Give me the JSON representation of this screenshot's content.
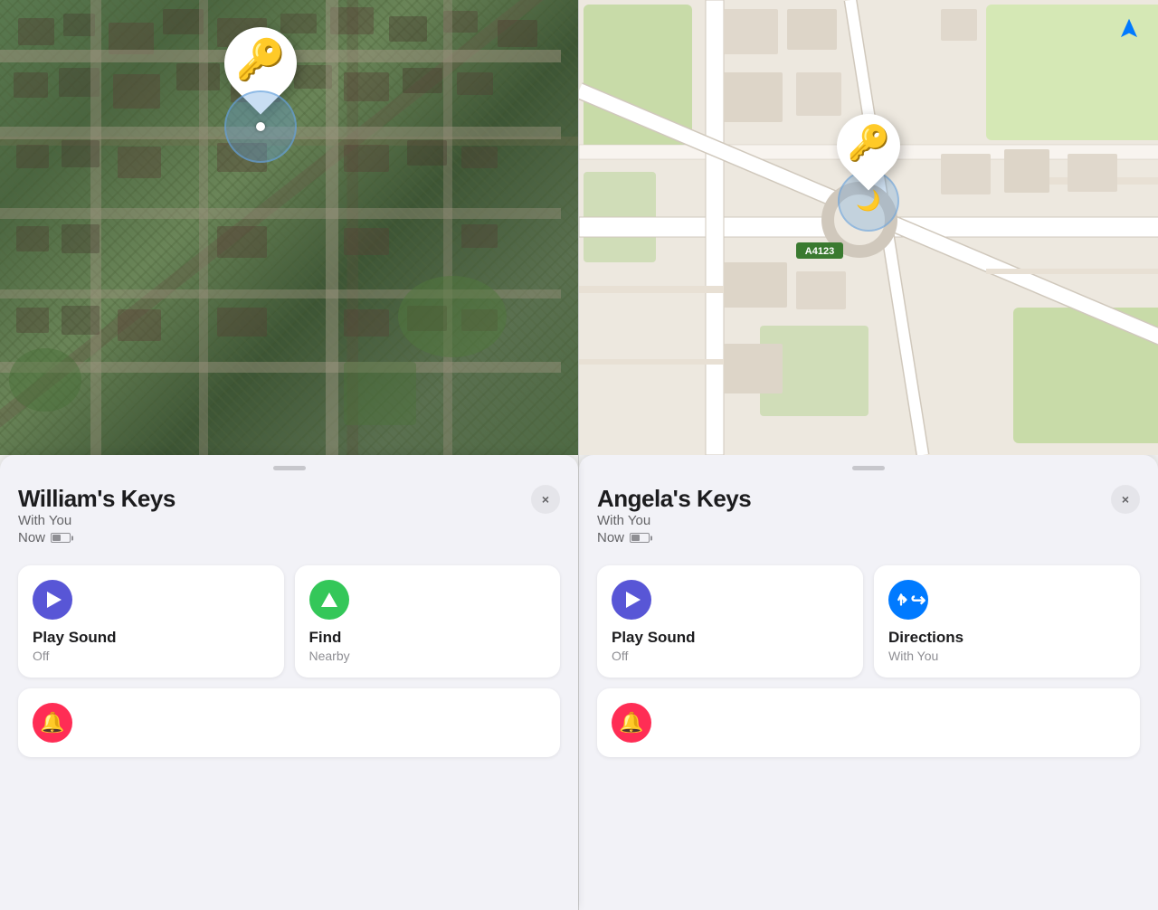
{
  "left": {
    "title": "William's Keys",
    "subtitle": "With You",
    "time": "Now",
    "actions": [
      {
        "id": "play-sound",
        "label": "Play Sound",
        "sublabel": "Off",
        "icon": "play",
        "iconColor": "purple"
      },
      {
        "id": "find-nearby",
        "label": "Find",
        "sublabel": "Nearby",
        "icon": "arrow-up",
        "iconColor": "green"
      }
    ],
    "notification_label": "Notify",
    "close_label": "×"
  },
  "right": {
    "title": "Angela's Keys",
    "subtitle": "With You",
    "time": "Now",
    "actions": [
      {
        "id": "play-sound",
        "label": "Play Sound",
        "sublabel": "Off",
        "icon": "play",
        "iconColor": "purple"
      },
      {
        "id": "directions",
        "label": "Directions",
        "sublabel": "With You",
        "icon": "turn",
        "iconColor": "blue"
      }
    ],
    "notification_label": "Notify",
    "close_label": "×",
    "road_label": "A4123"
  }
}
